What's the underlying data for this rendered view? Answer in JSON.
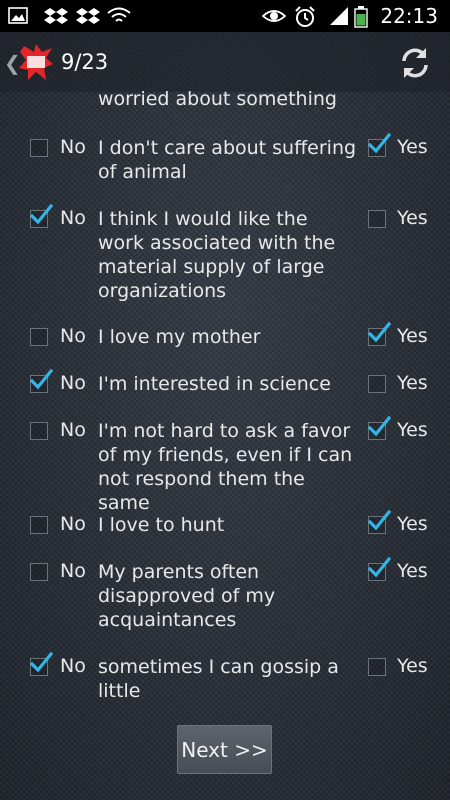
{
  "status_bar": {
    "time": "22:13",
    "icons": [
      "image-icon",
      "dropbox-icon",
      "dropbox-icon",
      "wifi-icon",
      "eye-icon",
      "alarm-icon",
      "signal-icon",
      "battery-icon"
    ],
    "battery_color": "#4caf50"
  },
  "action_bar": {
    "counter": "9/23",
    "logo_color": "#e3262a",
    "refresh_icon": "refresh-icon"
  },
  "question_fragment": "worried about something",
  "questions": [
    {
      "text": "I don't care about suffering of animal",
      "no_label": "No",
      "yes_label": "Yes",
      "no_checked": false,
      "yes_checked": true
    },
    {
      "text": "I think I would like the work associated with the material supply of large organizations",
      "no_label": "No",
      "yes_label": "Yes",
      "no_checked": true,
      "yes_checked": false
    },
    {
      "text": "I love my mother",
      "no_label": "No",
      "yes_label": "Yes",
      "no_checked": false,
      "yes_checked": true
    },
    {
      "text": "I'm interested in science",
      "no_label": "No",
      "yes_label": "Yes",
      "no_checked": true,
      "yes_checked": false
    },
    {
      "text": "I'm not hard to ask a favor of my friends, even if I can not respond them the same",
      "no_label": "No",
      "yes_label": "Yes",
      "no_checked": false,
      "yes_checked": true
    },
    {
      "text": "I love to hunt",
      "no_label": "No",
      "yes_label": "Yes",
      "no_checked": false,
      "yes_checked": true
    },
    {
      "text": "My parents often disapproved of my acquaintances",
      "no_label": "No",
      "yes_label": "Yes",
      "no_checked": false,
      "yes_checked": true
    },
    {
      "text": "sometimes I can gossip a little",
      "no_label": "No",
      "yes_label": "Yes",
      "no_checked": true,
      "yes_checked": false
    }
  ],
  "check_color": "#33b5e5",
  "next_button": "Next >>"
}
